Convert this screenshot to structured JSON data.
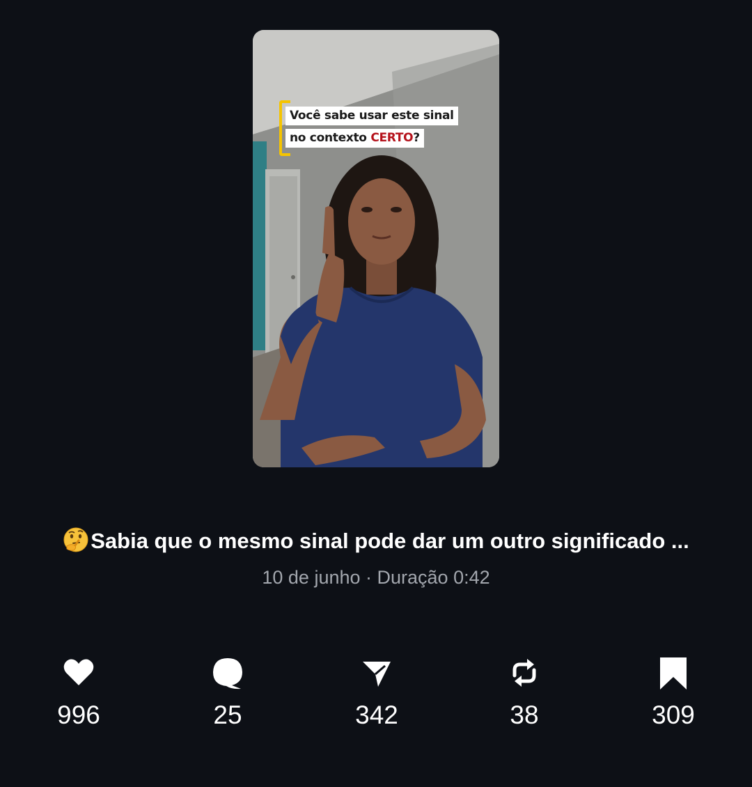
{
  "video": {
    "caption_line1": "Você sabe usar este sinal",
    "caption_line2_prefix": "no contexto ",
    "caption_line2_highlight": "CERTO",
    "caption_line2_suffix": "?"
  },
  "post": {
    "emoji": "thinking-face-emoji",
    "title": "Sabia que o mesmo sinal pode dar um outro significado ...",
    "date": "10 de junho",
    "separator": " · ",
    "duration_label": "Duração 0:42"
  },
  "stats": {
    "likes": "996",
    "comments": "25",
    "shares": "342",
    "reposts": "38",
    "saves": "309"
  },
  "icons": {
    "likes": "heart-icon",
    "comments": "comment-bubble-icon",
    "shares": "send-icon",
    "reposts": "repost-icon",
    "saves": "bookmark-icon"
  },
  "colors": {
    "background": "#0d1016",
    "text": "#ffffff",
    "muted": "#a3a7ae",
    "caption_highlight": "#b5121b",
    "caption_bracket": "#f5c400"
  }
}
